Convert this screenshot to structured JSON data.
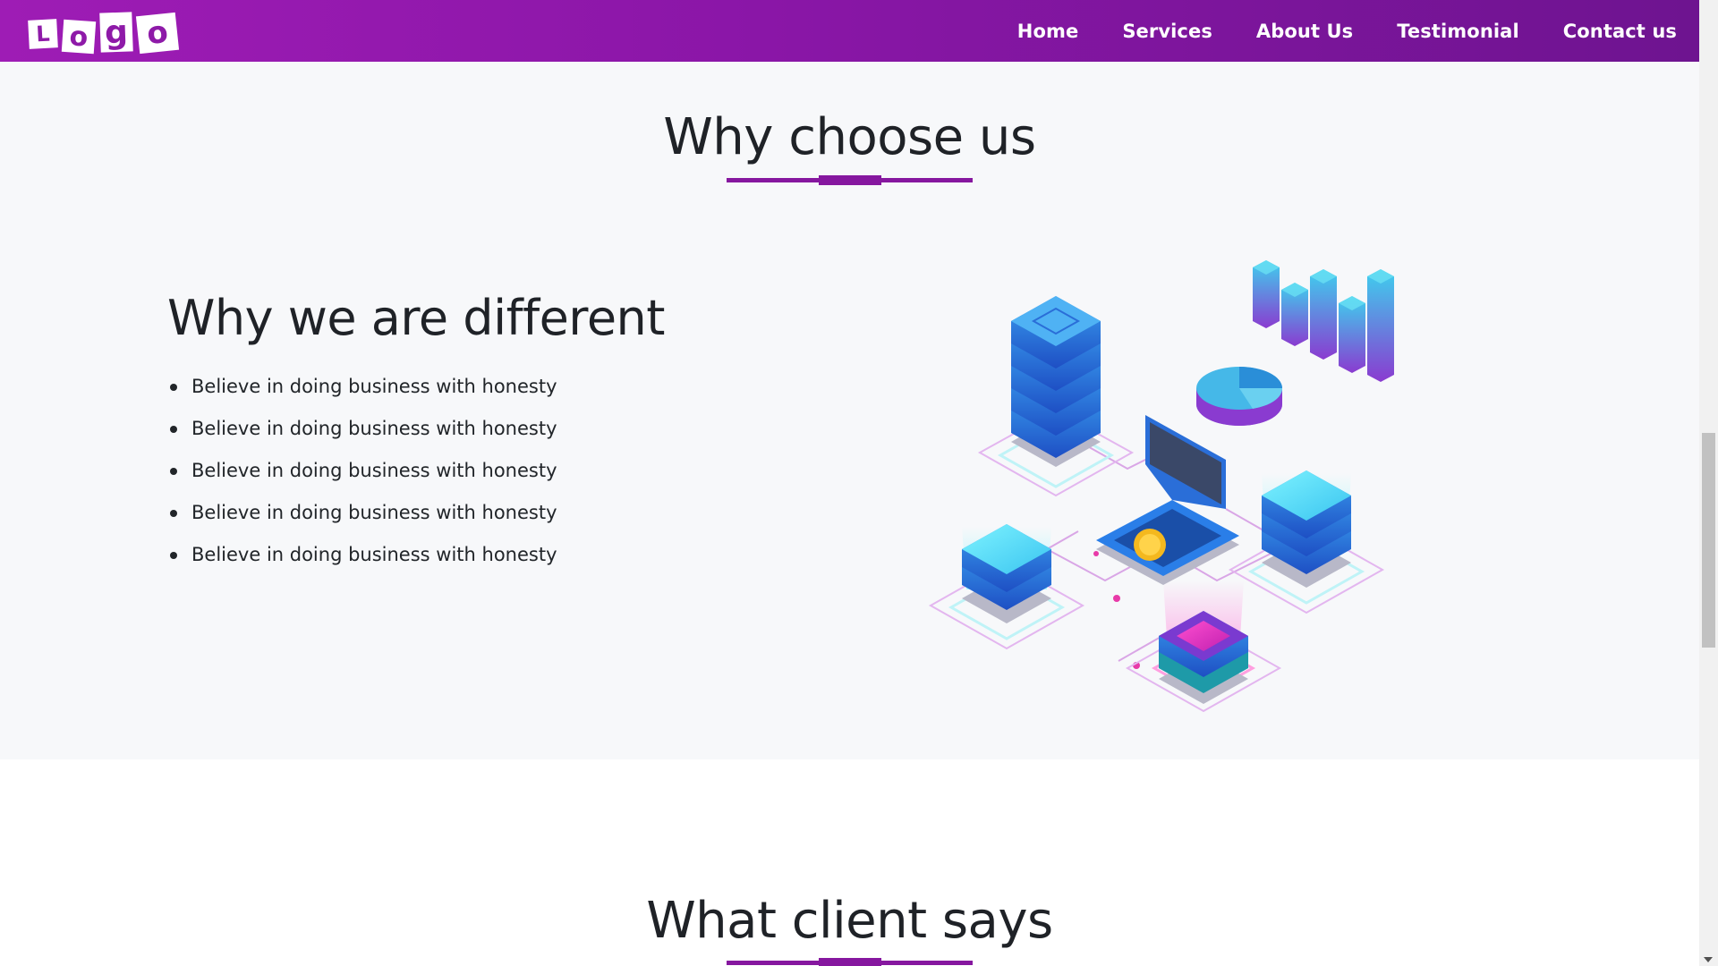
{
  "navbar": {
    "logo_letters": [
      "L",
      "o",
      "g",
      "o"
    ],
    "links": [
      "Home",
      "Services",
      "About Us",
      "Testimonial",
      "Contact us"
    ]
  },
  "why_section": {
    "title": "Why choose us",
    "heading": "Why we are different",
    "items": [
      "Believe in doing business with honesty",
      "Believe in doing business with honesty",
      "Believe in doing business with honesty",
      "Believe in doing business with honesty",
      "Believe in doing business with honesty"
    ],
    "illustration_icon": "isometric-data-center-illustration"
  },
  "client_section": {
    "title": "What client says"
  },
  "colors": {
    "brand_purple": "#86179f",
    "nav_gradient_start": "#9e1cb5",
    "nav_gradient_end": "#6e1490",
    "section_bg": "#f7f8fa"
  }
}
